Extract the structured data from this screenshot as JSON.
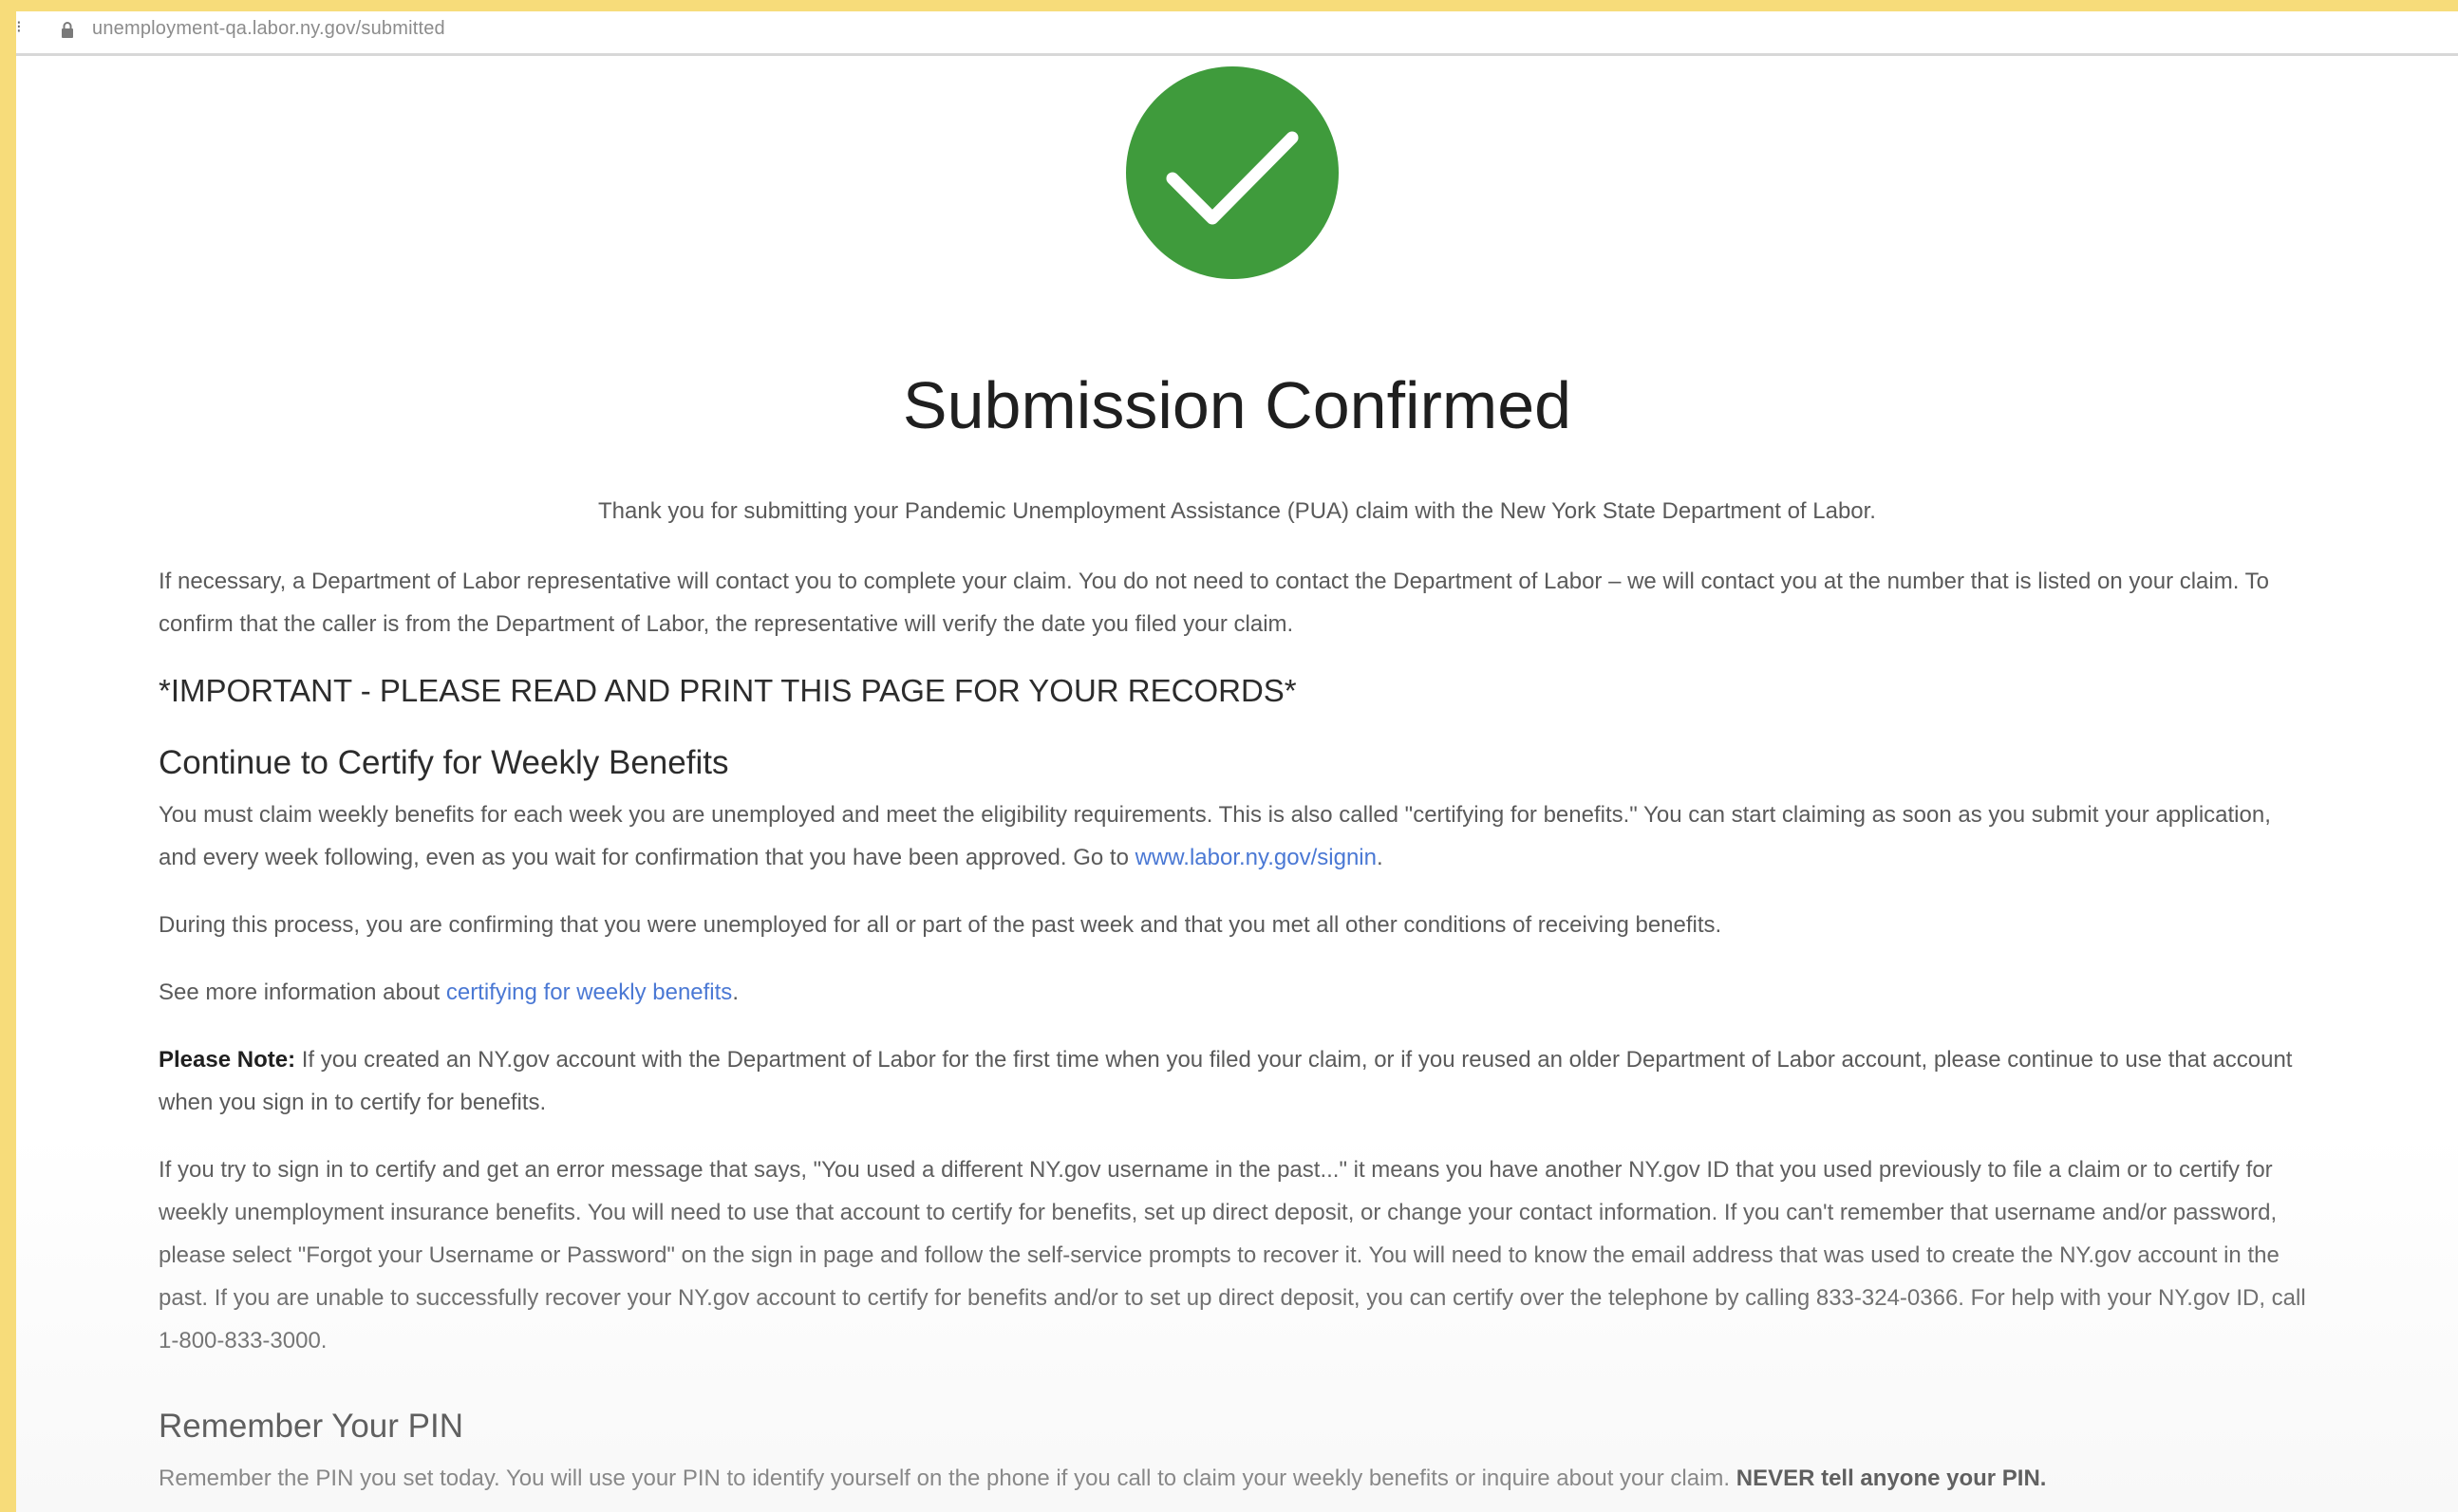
{
  "browser": {
    "url": "unemployment-qa.labor.ny.gov/submitted"
  },
  "colors": {
    "check_circle": "#3f9b3c",
    "link": "#4a78d4"
  },
  "page": {
    "title": "Submission Confirmed",
    "intro": "Thank you for submitting your Pandemic Unemployment Assistance (PUA) claim with the New York State Department of Labor.",
    "contact_paragraph": "If necessary, a Department of Labor representative will contact you to complete your claim. You do not need to contact the Department of Labor – we will contact you at the number that is listed on your claim. To confirm that the caller is from the Department of Labor, the representative will verify the date you filed your claim.",
    "important_notice": "*IMPORTANT - PLEASE READ AND PRINT THIS PAGE FOR YOUR RECORDS*",
    "certify": {
      "heading": "Continue to Certify for Weekly Benefits",
      "paragraph_text": "You must claim weekly benefits for each week you are unemployed and meet the eligibility requirements. This is also called \"certifying for benefits.\" You can start claiming as soon as you submit your application, and every week following, even as you wait for confirmation that you have been approved. Go to ",
      "signin_link": "www.labor.ny.gov/signin",
      "paragraph_end": ".",
      "process_paragraph": "During this process, you are confirming that you were unemployed for all or part of the past week and that you met all other conditions of receiving benefits.",
      "more_info_text": "See more information about ",
      "more_info_link": "certifying for weekly benefits",
      "more_info_end": "."
    },
    "note": {
      "label": "Please Note:",
      "text": " If you created an NY.gov account with the Department of Labor for the first time when you filed your claim, or if you reused an older Department of Labor account, please continue to use that account when you sign in to certify for benefits."
    },
    "error_paragraph": "If you try to sign in to certify and get an error message that says, \"You used a different NY.gov username in the past...\" it means you have another NY.gov ID that you used previously to file a claim or to certify for weekly unemployment insurance benefits. You will need to use that account to certify for benefits, set up direct deposit, or change your contact information. If you can't remember that username and/or password, please select \"Forgot your Username or Password\" on the sign in page and follow the self-service prompts to recover it. You will need to know the email address that was used to create the NY.gov account in the past. If you are unable to successfully recover your NY.gov account to certify for benefits and/or to set up direct deposit, you can certify over the telephone by calling 833-324-0366. For help with your NY.gov ID, call 1-800-833-3000.",
    "pin": {
      "heading": "Remember Your PIN",
      "text": "Remember the PIN you set today. You will use your PIN to identify yourself on the phone if you call to claim your weekly benefits or inquire about your claim. ",
      "bold": "NEVER tell anyone your PIN."
    }
  }
}
